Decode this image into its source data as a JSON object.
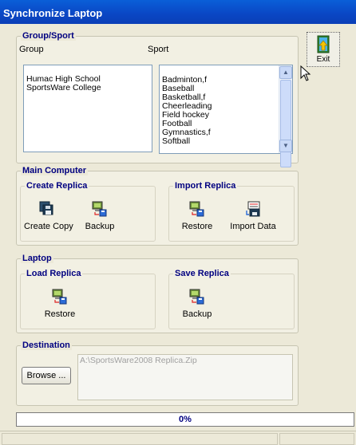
{
  "window": {
    "title": "Synchronize Laptop"
  },
  "exit": {
    "label": "Exit",
    "icon": "exit-door-icon"
  },
  "group_sport": {
    "title": "Group/Sport",
    "group_header": "Group",
    "sport_header": "Sport",
    "groups": [
      "Humac High School",
      "SportsWare College"
    ],
    "sports": [
      "Badminton,f",
      "Baseball",
      "Basketball,f",
      "Cheerleading",
      "Field hockey",
      "Football",
      "Gymnastics,f",
      "Softball"
    ]
  },
  "main_computer": {
    "title": "Main Computer",
    "create_replica": {
      "title": "Create Replica",
      "create_copy_label": "Create Copy",
      "backup_label": "Backup"
    },
    "import_replica": {
      "title": "Import Replica",
      "restore_label": "Restore",
      "import_data_label": "Import Data"
    }
  },
  "laptop": {
    "title": "Laptop",
    "load_replica": {
      "title": "Load Replica",
      "restore_label": "Restore"
    },
    "save_replica": {
      "title": "Save Replica",
      "backup_label": "Backup"
    }
  },
  "destination": {
    "title": "Destination",
    "browse_label": "Browse ...",
    "path_value": "A:\\SportsWare2008 Replica.Zip"
  },
  "progress": {
    "value_percent": 0,
    "label": "0%"
  },
  "colors": {
    "title_bar": "#0a46c4",
    "group_title": "#000080",
    "background": "#ece9d8"
  }
}
